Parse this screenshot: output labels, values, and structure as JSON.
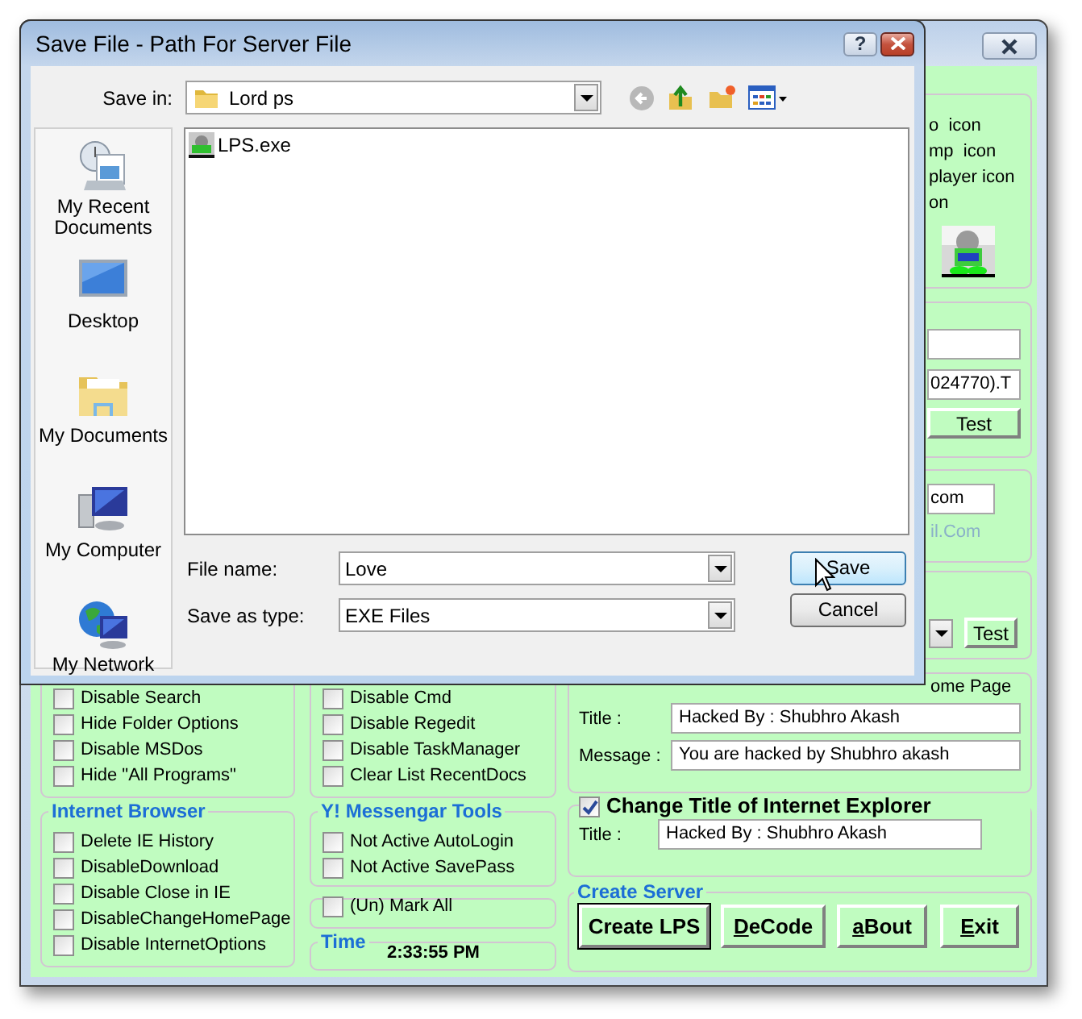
{
  "main_window": {
    "system_group": {
      "items": [
        {
          "label": "Disable Search",
          "checked": false
        },
        {
          "label": "Hide Folder Options",
          "checked": false
        },
        {
          "label": "Disable MSDos",
          "checked": false
        },
        {
          "label": "Hide \"All Programs\"",
          "checked": false
        }
      ]
    },
    "tools_group": {
      "items": [
        {
          "label": "Disable Cmd",
          "checked": false
        },
        {
          "label": "Disable Regedit",
          "checked": false
        },
        {
          "label": "Disable TaskManager",
          "checked": false
        },
        {
          "label": "Clear List RecentDocs",
          "checked": false
        }
      ]
    },
    "internet_browser": {
      "title": "Internet Browser",
      "items": [
        {
          "label": "Delete IE History",
          "checked": false
        },
        {
          "label": "DisableDownload",
          "checked": false
        },
        {
          "label": "Disable Close in IE",
          "checked": false
        },
        {
          "label": "DisableChangeHomePage",
          "checked": false
        },
        {
          "label": "Disable InternetOptions",
          "checked": false
        }
      ]
    },
    "messenger_tools": {
      "title": "Y! Messengar Tools",
      "items": [
        {
          "label": "Not Active AutoLogin",
          "checked": false
        },
        {
          "label": "Not Active SavePass",
          "checked": false
        }
      ]
    },
    "mark_all": {
      "label": "(Un) Mark All",
      "checked": false
    },
    "time": {
      "title": "Time",
      "value": "2:33:55 PM"
    },
    "icon_options": {
      "lines": [
        "o  icon",
        "mp  icon",
        "player icon",
        "on"
      ]
    },
    "url_test": {
      "field_value": "024770).T",
      "button": "Test"
    },
    "mail": {
      "field_value": "com",
      "hint": "il.Com"
    },
    "select_test": {
      "button": "Test"
    },
    "home_page": {
      "title": "ome Page",
      "fields": [
        {
          "label": "Title :",
          "value": "Hacked By : Shubhro Akash"
        },
        {
          "label": "Message :",
          "value": "You are hacked by Shubhro akash"
        }
      ]
    },
    "ie_title": {
      "label": "Change Title of Internet Explorer",
      "checked": true,
      "fields": [
        {
          "label": "Title :",
          "value": "Hacked By : Shubhro Akash"
        }
      ]
    },
    "create_server": {
      "title": "Create Server",
      "buttons": [
        {
          "label": "Create LPS",
          "default": true,
          "first_letter_underlined": false
        },
        {
          "label": "DeCode",
          "default": false,
          "first_letter_underlined": true
        },
        {
          "label": "aBout",
          "default": false,
          "first_letter_underlined": true
        },
        {
          "label": "Exit",
          "default": false,
          "first_letter_underlined": true
        }
      ]
    }
  },
  "dialog": {
    "title": "Save File - Path For Server File",
    "help": "?",
    "save_in": {
      "label": "Save in:",
      "value": "Lord ps"
    },
    "places": [
      {
        "label": "My Recent Documents",
        "kind": "recent"
      },
      {
        "label": "Desktop",
        "kind": "desktop"
      },
      {
        "label": "My Documents",
        "kind": "documents"
      },
      {
        "label": "My Computer",
        "kind": "computer"
      },
      {
        "label": "My Network",
        "kind": "network"
      }
    ],
    "files": [
      {
        "name": "LPS.exe"
      }
    ],
    "file_name": {
      "label": "File name:",
      "value": "Love"
    },
    "save_as_type": {
      "label": "Save as type:",
      "value": "EXE Files"
    },
    "buttons": [
      {
        "label": "Save",
        "hovered": true
      },
      {
        "label": "Cancel",
        "hovered": false
      }
    ]
  }
}
